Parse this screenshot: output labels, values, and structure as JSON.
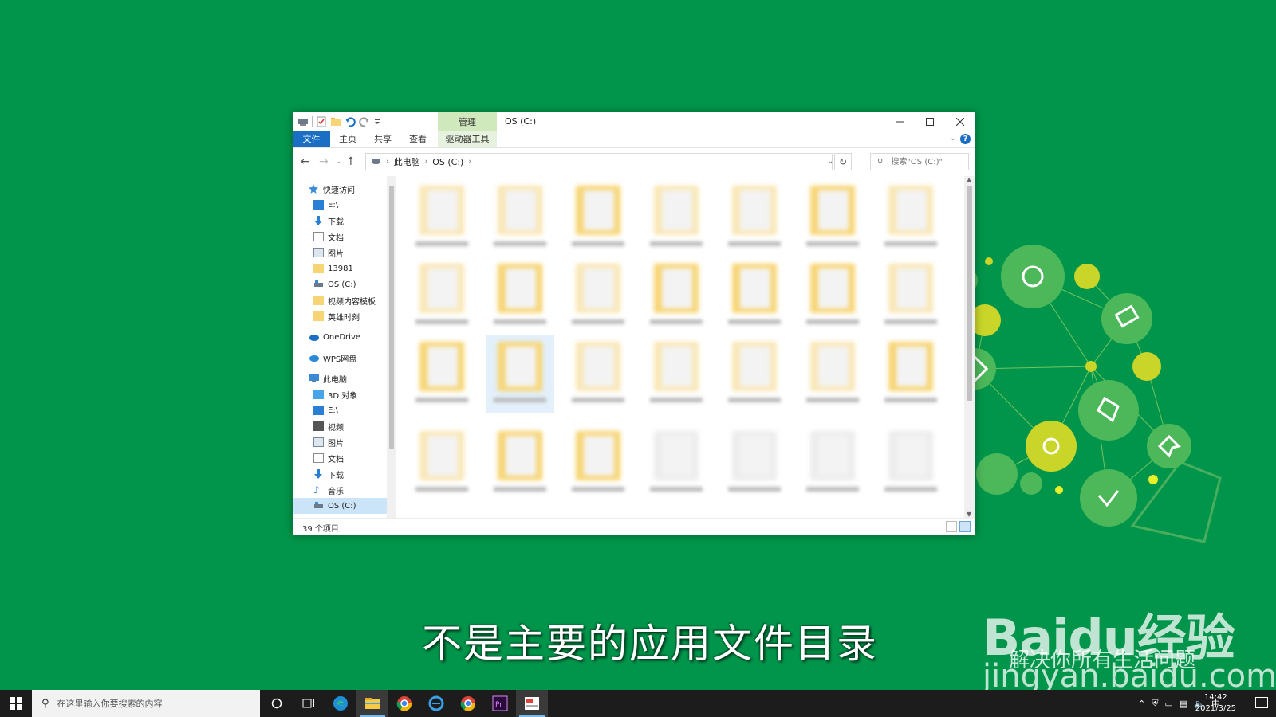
{
  "window": {
    "title": "OS (C:)",
    "contextual_tab": "管理",
    "ribbon_tabs": [
      "文件",
      "主页",
      "共享",
      "查看",
      "驱动器工具"
    ],
    "address": {
      "crumbs": [
        "此电脑",
        "OS (C:)"
      ]
    },
    "search_placeholder": "搜索\"OS (C:)\"",
    "status_count": "39 个项目"
  },
  "nav": {
    "quick_access": "快速访问",
    "quick_items": [
      {
        "label": "E:\\",
        "icon": "drive-icon",
        "pinned": true
      },
      {
        "label": "下载",
        "icon": "download-icon",
        "pinned": true
      },
      {
        "label": "文档",
        "icon": "document-icon",
        "pinned": true
      },
      {
        "label": "图片",
        "icon": "picture-icon",
        "pinned": true
      },
      {
        "label": "13981",
        "icon": "folder-icon",
        "pinned": false
      },
      {
        "label": "OS (C:)",
        "icon": "system-drive-icon",
        "pinned": false
      },
      {
        "label": "视频内容模板",
        "icon": "folder-icon",
        "pinned": false
      },
      {
        "label": "英雄时刻",
        "icon": "folder-icon",
        "pinned": false
      }
    ],
    "onedrive": "OneDrive",
    "wps": "WPS网盘",
    "this_pc": "此电脑",
    "pc_items": [
      {
        "label": "3D 对象",
        "icon": "3d-objects-icon"
      },
      {
        "label": "E:\\",
        "icon": "drive-icon"
      },
      {
        "label": "视频",
        "icon": "video-icon"
      },
      {
        "label": "图片",
        "icon": "picture-icon"
      },
      {
        "label": "文档",
        "icon": "document-icon"
      },
      {
        "label": "下载",
        "icon": "download-icon"
      },
      {
        "label": "音乐",
        "icon": "music-icon"
      },
      {
        "label": "OS (C:)",
        "icon": "system-drive-icon"
      }
    ]
  },
  "subtitle": "不是主要的应用文件目录",
  "watermark": {
    "logo": "Baidu经验",
    "tagline": "解决你所有生活问题",
    "url": "jingyan.baidu.com"
  },
  "taskbar": {
    "search_placeholder": "在这里输入你要搜索的内容",
    "time": "14:42",
    "date": "2021/3/25",
    "ime": "中"
  },
  "colors": {
    "background": "#00954a",
    "file_tab": "#1a6fc4",
    "manage_tab": "#cfe8bc",
    "folder": "#f7d574"
  }
}
